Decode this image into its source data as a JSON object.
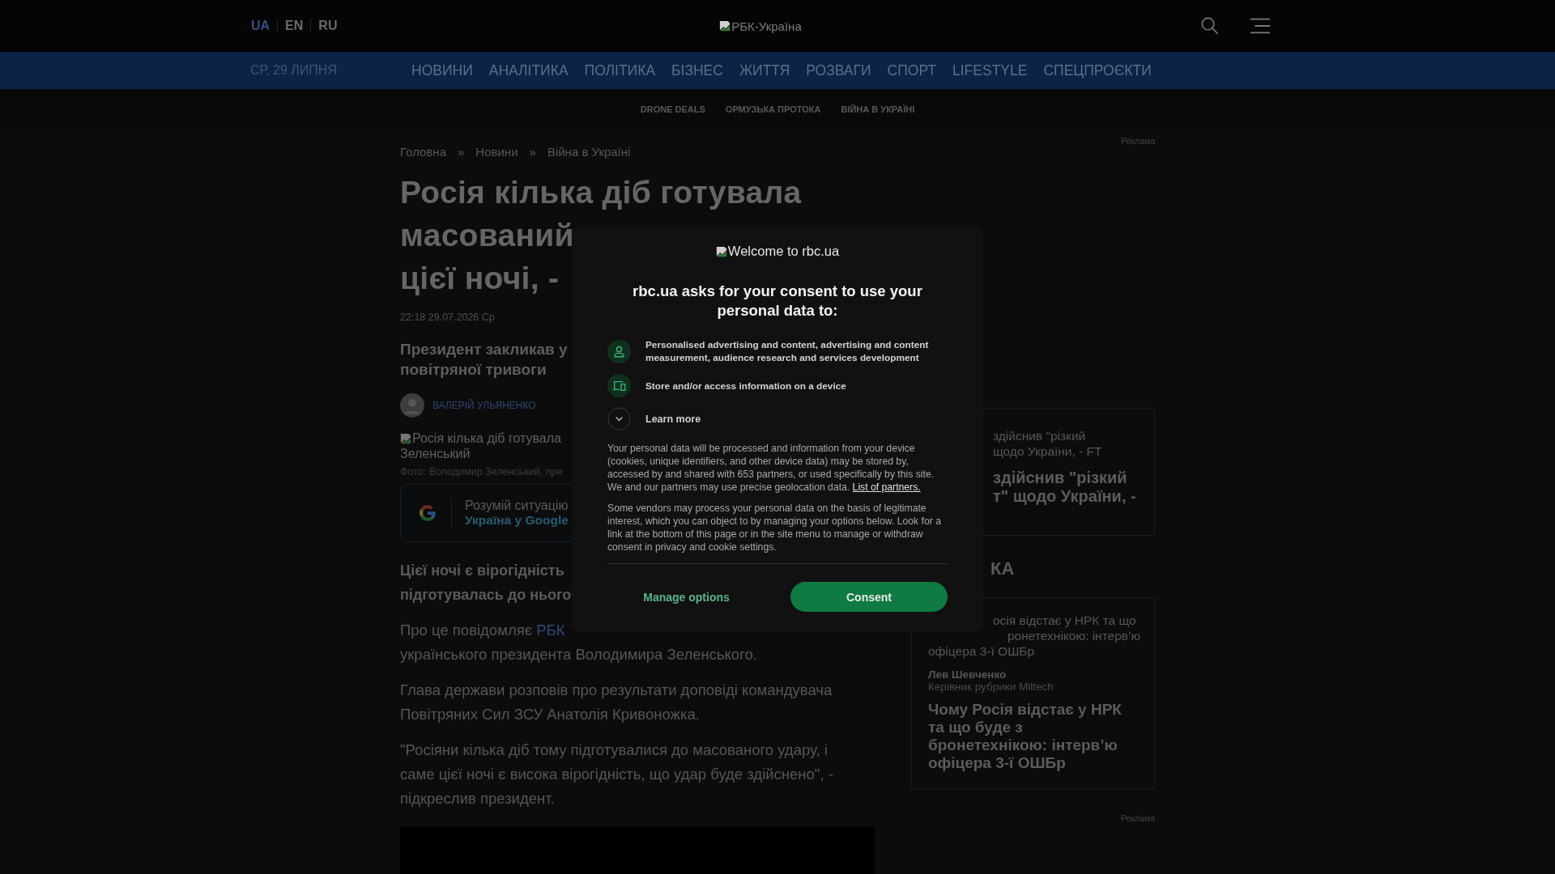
{
  "header": {
    "languages": [
      {
        "label": "UA",
        "selected": true
      },
      {
        "label": "EN",
        "selected": false
      },
      {
        "label": "RU",
        "selected": false
      }
    ],
    "logo_alt": "РБК-Україна",
    "date": "СР, 29 ЛИПНЯ",
    "nav": [
      "НОВИНИ",
      "АНАЛІТИКА",
      "ПОЛІТИКА",
      "БІЗНЕС",
      "ЖИТТЯ",
      "РОЗВАГИ",
      "СПОРТ",
      "LIFESTYLE",
      "СПЕЦПРОЄКТИ"
    ],
    "subnav": [
      "DRONE DEALS",
      "ОРМУЗЬКА ПРОТОКА",
      "ВІЙНА В УКРАЇНІ"
    ]
  },
  "article": {
    "breadcrumbs": [
      "Головна",
      "Новини",
      "Війна в Україні"
    ],
    "breadcrumb_separator": "»",
    "title_lines": [
      "Росія кілька діб готувала",
      "масований",
      "цієї ночі, -"
    ],
    "date": "22:18 29.07.2026 Ср",
    "subtitle_lines": [
      "Президент закликав у",
      "повітряної тривоги"
    ],
    "author": "ВАЛЕРІЙ УЛЬЯНЕНКО",
    "image_alt_lines": [
      "Росія кілька діб готувала",
      "Зеленський"
    ],
    "caption": "Фото: Володимир Зеленський, пре",
    "google_card": {
      "text": "Розумій ситуацію",
      "link": "Україна у Google"
    },
    "lead_lines": [
      "Цієї ночі є вірогідність",
      "підготувалась до нього"
    ],
    "source_paragraph": {
      "text": "Про це повідомляє ",
      "link": "РБК",
      "continuation": "українського президента Володимира Зеленського."
    },
    "paragraphs": [
      [
        "Глава держави розповів про результати доповіді командувача",
        "Повітряних Сил ЗСУ Анатолія Кривоножка."
      ],
      [
        "\"Росіяни кілька діб тому підготувалися до масованого удару, і",
        "саме цієї ночі є висока вірогідність, що удар буде здійснено\", -",
        "підкреслив президент."
      ]
    ]
  },
  "sidebar": {
    "ad_labels": [
      "Реклама",
      "Реклама"
    ],
    "news_card": {
      "small_lines": [
        "здійснив \"різкий",
        "щодо України, - FT"
      ],
      "big_lines": [
        "здійснив \"різкий",
        "т\" щодо України, -"
      ]
    },
    "section_title": "КА",
    "interview_card": {
      "small_lines": [
        "осія відстає у НРК та що",
        "ронетехнікою: інтерв’ю",
        "офіцера 3-ї ОШБр"
      ],
      "author": "Лев Шевченко",
      "author_role": "Керівник рубрики Miltech",
      "title": "Чому Росія відстає у НРК та що буде з бронетехнікою: інтерв’ю офіцера 3-ї ОШБр"
    }
  },
  "consent": {
    "logo_alt": "Welcome to rbc.ua",
    "heading": "rbc.ua asks for your consent to use your personal data to:",
    "purposes": [
      {
        "kind": "person",
        "text": "Personalised advertising and content, advertising and content measurement, audience research and services development"
      },
      {
        "kind": "device",
        "text": "Store and/or access information on a device"
      }
    ],
    "learn_more": {
      "label": "Learn more",
      "expanded": false
    },
    "body": "Your personal data will be processed and information from your device (cookies, unique identifiers, and other device data) may be stored by, accessed by and shared with 653 partners, or used specifically by this site. We and our partners may use precise geolocation data. ",
    "partners_link": "List of partners.",
    "vendors_note": "Some vendors may process your personal data on the basis of legitimate interest, which you can object to by managing your options below. Look for a link at the bottom of this page or in the site menu to manage or withdraw consent in privacy and cookie settings.",
    "manage_button": "Manage options",
    "consent_button": "Consent"
  }
}
